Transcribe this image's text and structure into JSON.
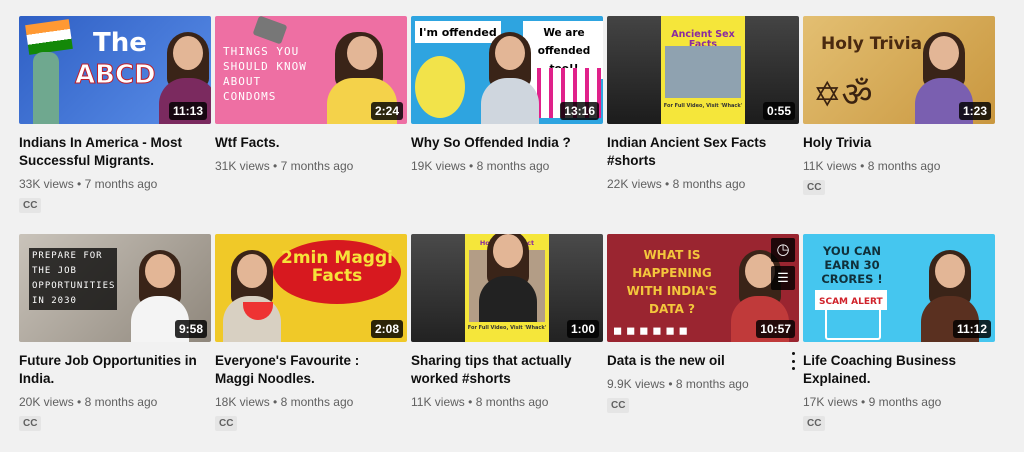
{
  "videos": [
    {
      "title": "Indians In America - Most Successful Migrants.",
      "views": "33K views",
      "age": "7 months ago",
      "duration": "11:13",
      "cc": "CC",
      "thumb_text": [
        "The",
        "ABCD"
      ],
      "bg": "#3b6fd1"
    },
    {
      "title": "Wtf Facts.",
      "views": "31K views",
      "age": "7 months ago",
      "duration": "2:24",
      "cc": null,
      "thumb_text": [
        "THINGS YOU SHOULD KNOW ABOUT CONDOMS"
      ],
      "bg": "#ee6fa3"
    },
    {
      "title": "Why So Offended India ?",
      "views": "19K views",
      "age": "8 months ago",
      "duration": "13:16",
      "cc": null,
      "thumb_text": [
        "I'm offended",
        "We are offended too!!"
      ],
      "bg": "#2ea4e0"
    },
    {
      "title": "Indian Ancient Sex Facts #shorts",
      "views": "22K views",
      "age": "8 months ago",
      "duration": "0:55",
      "cc": null,
      "thumb_text": [
        "Ancient Sex Facts",
        "For Full Video, Visit 'Whack'"
      ],
      "bg": "#2b2b2b"
    },
    {
      "title": "Holy Trivia",
      "views": "11K views",
      "age": "8 months ago",
      "duration": "1:23",
      "cc": "CC",
      "thumb_text": [
        "Holy Trivia"
      ],
      "bg": "#d8b062"
    },
    {
      "title": "Future Job Opportunities in India.",
      "views": "20K views",
      "age": "8 months ago",
      "duration": "9:58",
      "cc": "CC",
      "thumb_text": [
        "PREPARE FOR THE JOB OPPORTUNITIES IN 2030"
      ],
      "bg": "#b8b2a8"
    },
    {
      "title": "Everyone's Favourite : Maggi Noodles.",
      "views": "18K views",
      "age": "8 months ago",
      "duration": "2:08",
      "cc": "CC",
      "thumb_text": [
        "2min Maggi Facts"
      ],
      "bg": "#f0c928"
    },
    {
      "title": "Sharing tips that actually worked #shorts",
      "views": "11K views",
      "age": "8 months ago",
      "duration": "1:00",
      "cc": null,
      "thumb_text": [
        "How To Attract Women",
        "For Full Video, Visit 'Whack'"
      ],
      "bg": "#3a3a3a"
    },
    {
      "title": "Data is the new oil",
      "views": "9.9K views",
      "age": "8 months ago",
      "duration": "10:57",
      "cc": "CC",
      "thumb_text": [
        "WHAT IS HAPPENING WITH INDIA'S DATA ?"
      ],
      "bg": "#9a2530"
    },
    {
      "title": "Life Coaching Business Explained.",
      "views": "17K views",
      "age": "9 months ago",
      "duration": "11:12",
      "cc": "CC",
      "thumb_text": [
        "YOU CAN EARN 30 CRORES !",
        "SCAM ALERT"
      ],
      "bg": "#45c6ef"
    }
  ]
}
